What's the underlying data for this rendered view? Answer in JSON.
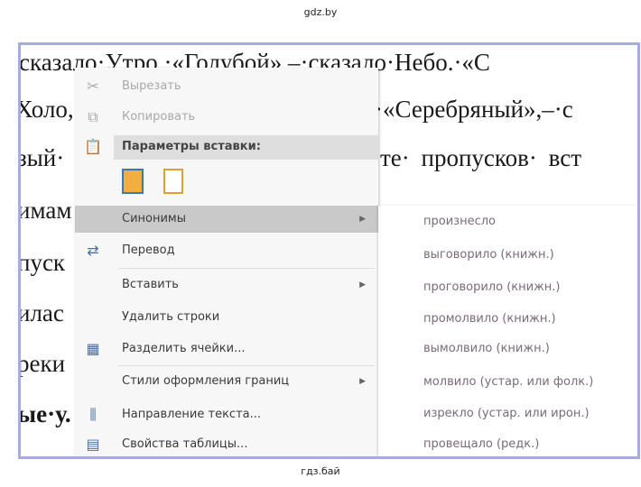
{
  "watermark_top": "gdz.by",
  "watermark_bottom": "гдз.бай",
  "document": {
    "lines": [
      "сказало·Утро.·«Голубой».–·сказало·Небо.·«С",
      "Холо,",
      "·«Серебряный»,–·с",
      "зый·",
      "те· пропусков· вст",
      "имам",
      "пуск",
      "илас",
      "реки",
      "ые·у."
    ]
  },
  "context_menu": {
    "cut": "Вырезать",
    "copy": "Копировать",
    "paste_options": "Параметры вставки:",
    "synonyms": "Синонимы",
    "translate": "Перевод",
    "insert": "Вставить",
    "delete_rows": "Удалить строки",
    "split_cells": "Разделить ячейки...",
    "border_styles": "Стили оформления границ",
    "text_direction": "Направление текста...",
    "table_properties": "Свойства таблицы..."
  },
  "synonyms_submenu": [
    "произнесло",
    "выговорило (книжн.)",
    "проговорило (книжн.)",
    "промолвило (книжн.)",
    "вымолвило (книжн.)",
    "молвило (устар. или фолк.)",
    "изрекло (устар. или ирон.)",
    "провещало (редк.)"
  ]
}
